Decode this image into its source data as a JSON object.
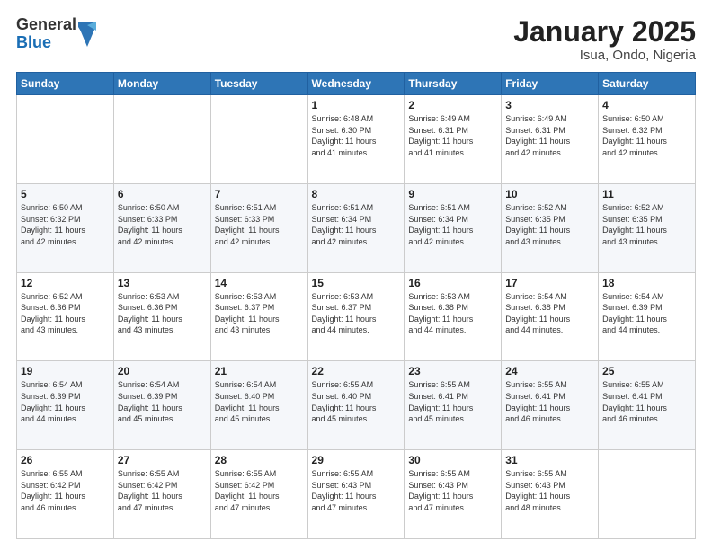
{
  "header": {
    "logo_general": "General",
    "logo_blue": "Blue",
    "month_title": "January 2025",
    "location": "Isua, Ondo, Nigeria"
  },
  "days_of_week": [
    "Sunday",
    "Monday",
    "Tuesday",
    "Wednesday",
    "Thursday",
    "Friday",
    "Saturday"
  ],
  "weeks": [
    [
      {
        "day": "",
        "info": ""
      },
      {
        "day": "",
        "info": ""
      },
      {
        "day": "",
        "info": ""
      },
      {
        "day": "1",
        "info": "Sunrise: 6:48 AM\nSunset: 6:30 PM\nDaylight: 11 hours\nand 41 minutes."
      },
      {
        "day": "2",
        "info": "Sunrise: 6:49 AM\nSunset: 6:31 PM\nDaylight: 11 hours\nand 41 minutes."
      },
      {
        "day": "3",
        "info": "Sunrise: 6:49 AM\nSunset: 6:31 PM\nDaylight: 11 hours\nand 42 minutes."
      },
      {
        "day": "4",
        "info": "Sunrise: 6:50 AM\nSunset: 6:32 PM\nDaylight: 11 hours\nand 42 minutes."
      }
    ],
    [
      {
        "day": "5",
        "info": "Sunrise: 6:50 AM\nSunset: 6:32 PM\nDaylight: 11 hours\nand 42 minutes."
      },
      {
        "day": "6",
        "info": "Sunrise: 6:50 AM\nSunset: 6:33 PM\nDaylight: 11 hours\nand 42 minutes."
      },
      {
        "day": "7",
        "info": "Sunrise: 6:51 AM\nSunset: 6:33 PM\nDaylight: 11 hours\nand 42 minutes."
      },
      {
        "day": "8",
        "info": "Sunrise: 6:51 AM\nSunset: 6:34 PM\nDaylight: 11 hours\nand 42 minutes."
      },
      {
        "day": "9",
        "info": "Sunrise: 6:51 AM\nSunset: 6:34 PM\nDaylight: 11 hours\nand 42 minutes."
      },
      {
        "day": "10",
        "info": "Sunrise: 6:52 AM\nSunset: 6:35 PM\nDaylight: 11 hours\nand 43 minutes."
      },
      {
        "day": "11",
        "info": "Sunrise: 6:52 AM\nSunset: 6:35 PM\nDaylight: 11 hours\nand 43 minutes."
      }
    ],
    [
      {
        "day": "12",
        "info": "Sunrise: 6:52 AM\nSunset: 6:36 PM\nDaylight: 11 hours\nand 43 minutes."
      },
      {
        "day": "13",
        "info": "Sunrise: 6:53 AM\nSunset: 6:36 PM\nDaylight: 11 hours\nand 43 minutes."
      },
      {
        "day": "14",
        "info": "Sunrise: 6:53 AM\nSunset: 6:37 PM\nDaylight: 11 hours\nand 43 minutes."
      },
      {
        "day": "15",
        "info": "Sunrise: 6:53 AM\nSunset: 6:37 PM\nDaylight: 11 hours\nand 44 minutes."
      },
      {
        "day": "16",
        "info": "Sunrise: 6:53 AM\nSunset: 6:38 PM\nDaylight: 11 hours\nand 44 minutes."
      },
      {
        "day": "17",
        "info": "Sunrise: 6:54 AM\nSunset: 6:38 PM\nDaylight: 11 hours\nand 44 minutes."
      },
      {
        "day": "18",
        "info": "Sunrise: 6:54 AM\nSunset: 6:39 PM\nDaylight: 11 hours\nand 44 minutes."
      }
    ],
    [
      {
        "day": "19",
        "info": "Sunrise: 6:54 AM\nSunset: 6:39 PM\nDaylight: 11 hours\nand 44 minutes."
      },
      {
        "day": "20",
        "info": "Sunrise: 6:54 AM\nSunset: 6:39 PM\nDaylight: 11 hours\nand 45 minutes."
      },
      {
        "day": "21",
        "info": "Sunrise: 6:54 AM\nSunset: 6:40 PM\nDaylight: 11 hours\nand 45 minutes."
      },
      {
        "day": "22",
        "info": "Sunrise: 6:55 AM\nSunset: 6:40 PM\nDaylight: 11 hours\nand 45 minutes."
      },
      {
        "day": "23",
        "info": "Sunrise: 6:55 AM\nSunset: 6:41 PM\nDaylight: 11 hours\nand 45 minutes."
      },
      {
        "day": "24",
        "info": "Sunrise: 6:55 AM\nSunset: 6:41 PM\nDaylight: 11 hours\nand 46 minutes."
      },
      {
        "day": "25",
        "info": "Sunrise: 6:55 AM\nSunset: 6:41 PM\nDaylight: 11 hours\nand 46 minutes."
      }
    ],
    [
      {
        "day": "26",
        "info": "Sunrise: 6:55 AM\nSunset: 6:42 PM\nDaylight: 11 hours\nand 46 minutes."
      },
      {
        "day": "27",
        "info": "Sunrise: 6:55 AM\nSunset: 6:42 PM\nDaylight: 11 hours\nand 47 minutes."
      },
      {
        "day": "28",
        "info": "Sunrise: 6:55 AM\nSunset: 6:42 PM\nDaylight: 11 hours\nand 47 minutes."
      },
      {
        "day": "29",
        "info": "Sunrise: 6:55 AM\nSunset: 6:43 PM\nDaylight: 11 hours\nand 47 minutes."
      },
      {
        "day": "30",
        "info": "Sunrise: 6:55 AM\nSunset: 6:43 PM\nDaylight: 11 hours\nand 47 minutes."
      },
      {
        "day": "31",
        "info": "Sunrise: 6:55 AM\nSunset: 6:43 PM\nDaylight: 11 hours\nand 48 minutes."
      },
      {
        "day": "",
        "info": ""
      }
    ]
  ]
}
